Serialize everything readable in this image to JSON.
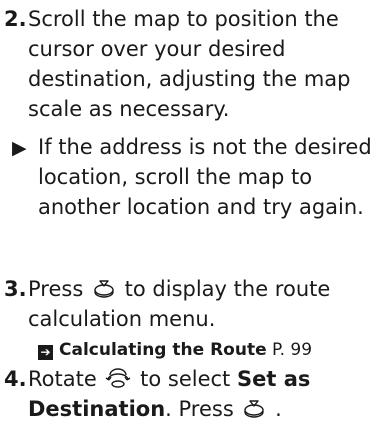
{
  "steps": [
    {
      "number": "2.",
      "lines": [
        "Scroll the map to position the",
        "cursor over your desired",
        "destination, adjusting the map",
        "scale as necessary."
      ],
      "note_lines": [
        "If the address is not the desired",
        "location, scroll the map to",
        "another location and try again."
      ]
    },
    {
      "number": "3.",
      "line1_before": "Press",
      "line1_icon": "enter-button-icon",
      "line1_after": "to display the route",
      "line2": "calculation menu.",
      "ref_title": "Calculating the Route",
      "ref_page": "P. 99"
    },
    {
      "number": "4.",
      "line1_before": "Rotate",
      "line1_icon": "interface-dial-icon",
      "line1_middle": "to select",
      "line1_bold": "Set as",
      "line2_bold": "Destination",
      "line2_after": ". Press",
      "line2_icon": "enter-button-icon"
    }
  ]
}
